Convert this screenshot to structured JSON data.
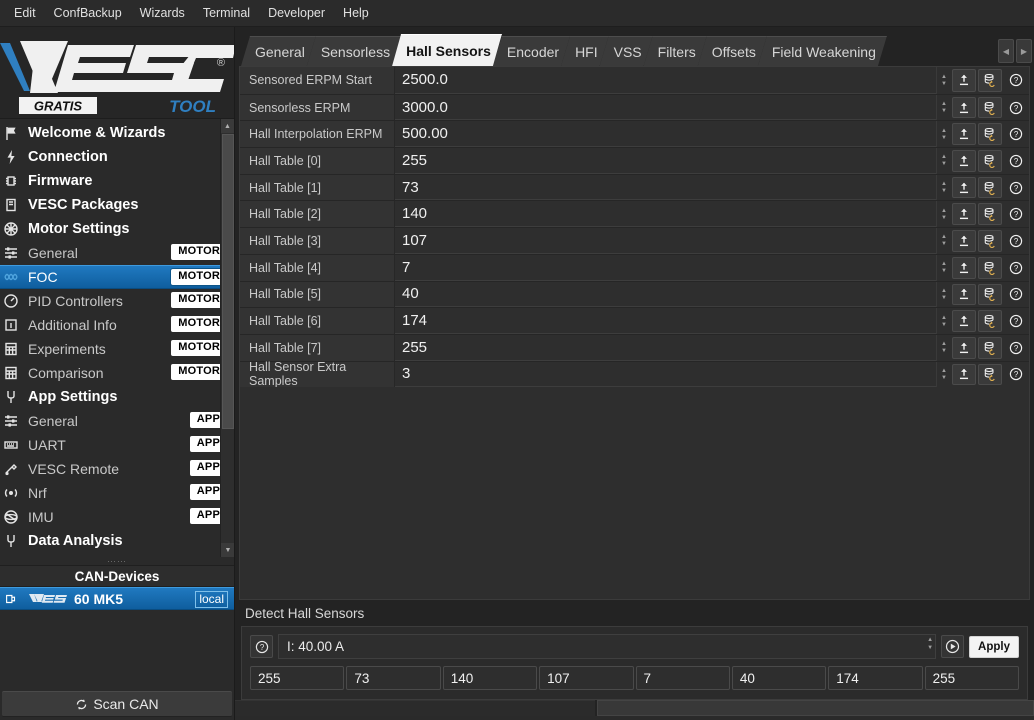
{
  "menu": {
    "items": [
      "Edit",
      "ConfBackup",
      "Wizards",
      "Terminal",
      "Developer",
      "Help"
    ]
  },
  "brand": {
    "name": "VESC",
    "registered": "®",
    "sub_left": "GRATIS",
    "sub_right": "TOOL"
  },
  "sidebar": {
    "tree": [
      {
        "label": "Welcome & Wizards",
        "icon": "flag-icon",
        "type": "group",
        "badge": ""
      },
      {
        "label": "Connection",
        "icon": "plug-icon",
        "type": "group",
        "badge": ""
      },
      {
        "label": "Firmware",
        "icon": "chip-icon",
        "type": "group",
        "badge": ""
      },
      {
        "label": "VESC Packages",
        "icon": "package-icon",
        "type": "group",
        "badge": ""
      },
      {
        "label": "Motor Settings",
        "icon": "motor-icon",
        "type": "group",
        "badge": ""
      },
      {
        "label": "General",
        "icon": "sliders-icon",
        "type": "child",
        "badge": "MOTOR"
      },
      {
        "label": "FOC",
        "icon": "waves-icon",
        "type": "child",
        "badge": "MOTOR",
        "selected": true
      },
      {
        "label": "PID Controllers",
        "icon": "gauge-icon",
        "type": "child",
        "badge": "MOTOR"
      },
      {
        "label": "Additional Info",
        "icon": "info-icon",
        "type": "child",
        "badge": "MOTOR"
      },
      {
        "label": "Experiments",
        "icon": "grid-icon",
        "type": "child",
        "badge": "MOTOR"
      },
      {
        "label": "Comparison",
        "icon": "grid-icon",
        "type": "child",
        "badge": "MOTOR"
      },
      {
        "label": "App Settings",
        "icon": "apps-icon",
        "type": "group",
        "badge": ""
      },
      {
        "label": "General",
        "icon": "sliders-icon",
        "type": "child",
        "badge": "APP"
      },
      {
        "label": "UART",
        "icon": "uart-icon",
        "type": "child",
        "badge": "APP"
      },
      {
        "label": "VESC Remote",
        "icon": "remote-icon",
        "type": "child",
        "badge": "APP"
      },
      {
        "label": "Nrf",
        "icon": "antenna-icon",
        "type": "child",
        "badge": "APP"
      },
      {
        "label": "IMU",
        "icon": "imu-icon",
        "type": "child",
        "badge": "APP"
      },
      {
        "label": "Data Analysis",
        "icon": "chart-icon",
        "type": "group",
        "badge": ""
      }
    ],
    "can_header": "CAN-Devices",
    "can_devices": [
      {
        "name": "60 MK5",
        "tag": "local",
        "logo": "vesc-logo-icon",
        "selected": true
      }
    ],
    "scan_can_label": "Scan CAN",
    "accent_color": "#1b6fb0"
  },
  "tabs": [
    {
      "label": "General",
      "active": false
    },
    {
      "label": "Sensorless",
      "active": false
    },
    {
      "label": "Hall Sensors",
      "active": true
    },
    {
      "label": "Encoder",
      "active": false
    },
    {
      "label": "HFI",
      "active": false
    },
    {
      "label": "VSS",
      "active": false
    },
    {
      "label": "Filters",
      "active": false
    },
    {
      "label": "Offsets",
      "active": false
    },
    {
      "label": "Field Weakening",
      "active": false
    }
  ],
  "params": [
    {
      "label": "Sensored ERPM Start",
      "value": "2500.0"
    },
    {
      "label": "Sensorless ERPM",
      "value": "3000.0"
    },
    {
      "label": "Hall Interpolation ERPM",
      "value": "500.00"
    },
    {
      "label": "Hall Table [0]",
      "value": "255"
    },
    {
      "label": "Hall Table [1]",
      "value": "73"
    },
    {
      "label": "Hall Table [2]",
      "value": "140"
    },
    {
      "label": "Hall Table [3]",
      "value": "107"
    },
    {
      "label": "Hall Table [4]",
      "value": "7"
    },
    {
      "label": "Hall Table [5]",
      "value": "40"
    },
    {
      "label": "Hall Table [6]",
      "value": "174"
    },
    {
      "label": "Hall Table [7]",
      "value": "255"
    },
    {
      "label": "Hall Sensor Extra Samples",
      "value": "3"
    }
  ],
  "row_buttons": {
    "upload": "upload-icon",
    "restore": "database-restore-icon",
    "help": "help-icon"
  },
  "detect": {
    "title": "Detect Hall Sensors",
    "help_icon": "help-icon",
    "current_value": "I: 40.00 A",
    "run_icon": "play-icon",
    "apply_label": "Apply",
    "results": [
      "255",
      "73",
      "140",
      "107",
      "7",
      "40",
      "174",
      "255"
    ]
  }
}
